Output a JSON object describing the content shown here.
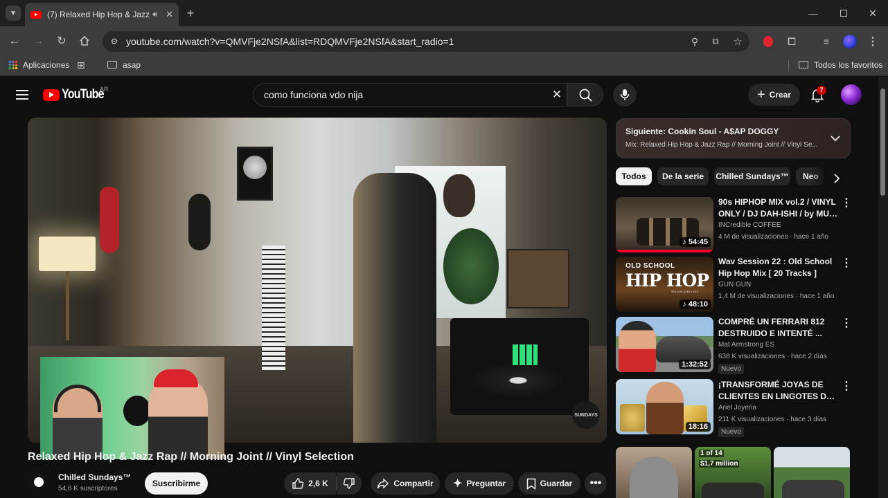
{
  "browser": {
    "tab_title": "(7) Relaxed Hip Hop & Jazz",
    "url": "youtube.com/watch?v=QMVFje2NSfA&list=RDQMVFje2NSfA&start_radio=1",
    "bookmarks": {
      "apps": "Aplicaciones",
      "folder": "asap",
      "all": "Todos los favoritos"
    }
  },
  "header": {
    "logo": "YouTube",
    "country": "AR",
    "search_value": "como funciona vdo nija",
    "create": "Crear",
    "notifications": "7"
  },
  "video": {
    "title": "Relaxed Hip Hop & Jazz Rap // Morning Joint // Vinyl Selection",
    "channel": "Chilled Sundays™",
    "subscribers": "54,6 K suscriptores",
    "subscribe": "Suscribirme",
    "likes": "2,6 K",
    "share": "Compartir",
    "ask": "Preguntar",
    "save": "Guardar",
    "overlay_text": "SUNDAYS"
  },
  "playlist": {
    "next": "Siguiente: Cookin Soul - A$AP DOGGY",
    "subtitle": "Mix: Relaxed Hip Hop & Jazz Rap // Morning Joint // Vinyl Se..."
  },
  "chips": [
    "Todos",
    "De la serie",
    "Chilled Sundays™",
    "Neo"
  ],
  "recommendations": [
    {
      "title1": "90s HIPHOP MIX vol.2 / VINYL",
      "title2": "ONLY / DJ DAH-ISHI / by MUSI...",
      "channel": "INCredible COFFEE",
      "meta": "4 M de visualizaciones · hace 1 año",
      "duration": "54:45",
      "badge": ""
    },
    {
      "title1": "Wav Session 22 : Old School",
      "title2": "Hip Hop Mix [ 20 Tracks ]",
      "channel": "GUN GUN",
      "meta": "1,4 M de visualizaciones · hace 1 año",
      "duration": "48:10",
      "badge": "",
      "thumb_text": "OLD SCHOOL",
      "thumb_big": "HIP HOP",
      "thumb_small": "90's AND EARLY 00's"
    },
    {
      "title1": "COMPRÉ UN FERRARI 812",
      "title2": "DESTRUIDO E INTENTÉ ...",
      "channel": "Mat Armstrong ES",
      "meta": "638 K visualizaciones · hace 2 días",
      "duration": "1:32:52",
      "badge": "Nuevo"
    },
    {
      "title1": "¡TRANSFORMÉ JOYAS DE",
      "title2": "CLIENTES EN LINGOTES DE ...",
      "channel": "Ariel Joyeria",
      "meta": "211 K visualizaciones · hace 3 días",
      "duration": "18:16",
      "badge": "Nuevo"
    }
  ],
  "shorts": {
    "s2_line1": "1 of 14",
    "s2_line2": "$1,7 million"
  },
  "colors": {
    "yt_red": "#ff0000",
    "bg": "#0f0f0f",
    "chip": "#272727"
  }
}
